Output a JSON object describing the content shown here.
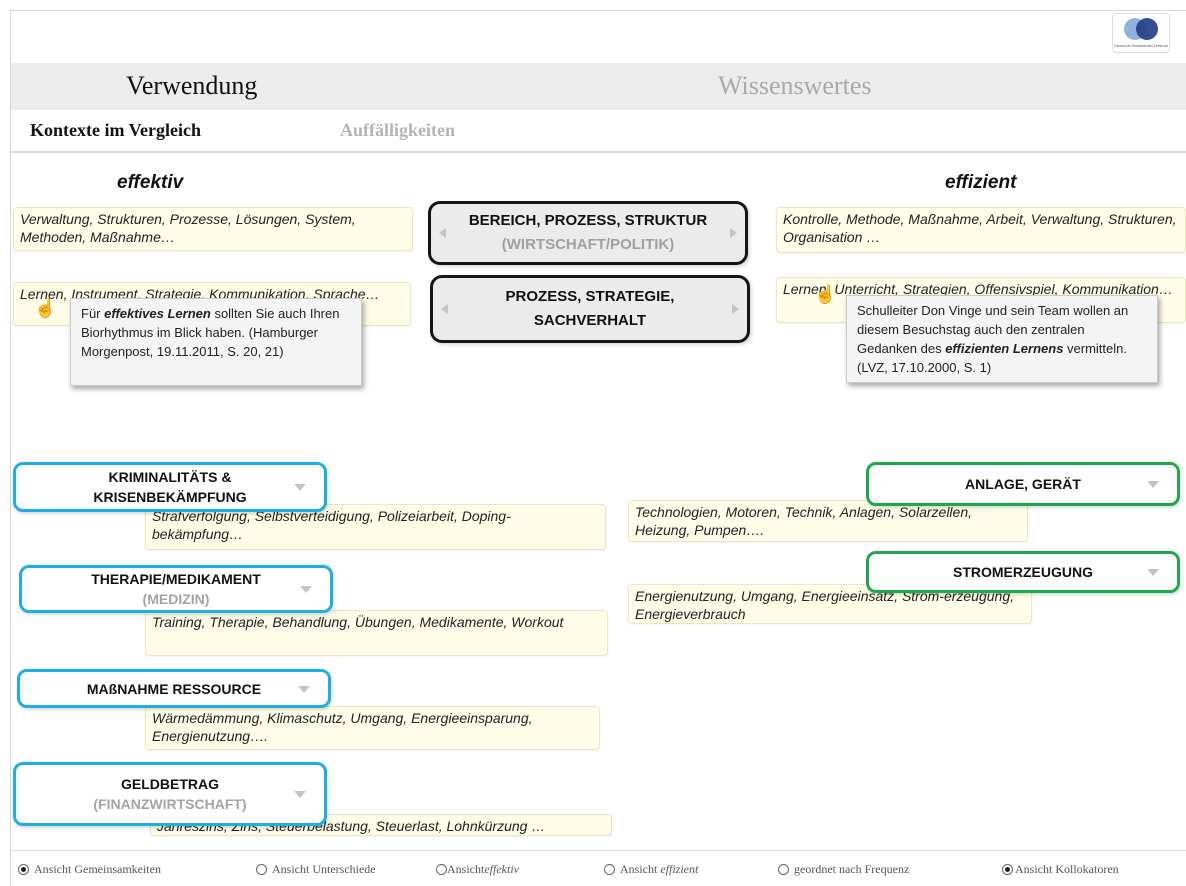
{
  "logo": {
    "icon": "overlapping-circles-logo",
    "text": "Deutsche Wortschatz-Zentrum"
  },
  "tabs": {
    "active": "Verwendung",
    "inactive": "Wissenswertes"
  },
  "subtabs": {
    "active": "Kontexte im Vergleich",
    "inactive": "Auffälligkeiten"
  },
  "columns": {
    "left": "effektiv",
    "right": "effizient"
  },
  "center_boxes": [
    {
      "line1": "BEREICH, PROZESS, STRUKTUR",
      "line2": "(WIRTSCHAFT/POLITIK)"
    },
    {
      "line1": "PROZESS, STRATEGIE,",
      "line2": "SACHVERHALT"
    }
  ],
  "left_notes": [
    "Verwaltung,  Strukturen,  Prozesse, Lösungen, System,  Methoden,  Maßnahme…",
    "Lernen,  Instrument,  Strategie,  Kommunikation, Sprache…"
  ],
  "right_notes": [
    "Kontrolle,  Methode,  Maßnahme,  Arbeit, Verwaltung,  Strukturen,  Organisation  …",
    "Lernen,  Unterricht,  Strategien,  Offensivspiel, Kommunikation…"
  ],
  "tooltips": {
    "left": {
      "pre": "Für ",
      "bold": "effektives Lernen",
      "post": " sollten Sie auch Ihren Biorhythmus im Blick haben. (Hamburger Morgenpost, 19.11.2011, S. 20, 21)"
    },
    "right": {
      "pre": "Schulleiter Don Vinge und sein Team wollen an diesem Besuchstag auch den zentralen Gedanken des ",
      "bold": "effizienten Lernens",
      "post": " vermitteln. (LVZ, 17.10.2000, S. 1)"
    }
  },
  "left_categories": [
    {
      "line1": "KRIMINALITÄTS &",
      "line2": "KRISENBEKÄMPFUNG",
      "note": "Strafverfolgung,  Selbstverteidigung,  Polizeiarbeit,  Doping-bekämpfung…"
    },
    {
      "line1": "THERAPIE/MEDIKAMENT",
      "line2": "(MEDIZIN)",
      "note": "Training,  Therapie,  Behandlung,  Übungen,  Medikamente, Workout"
    },
    {
      "line1": "MAßNAHME  RESSOURCE",
      "line2": "",
      "note": "Wärmedämmung,  Klimaschutz,  Umgang, Energieeinsparung,  Energienutzung…."
    },
    {
      "line1": "GELDBETRAG",
      "line2": "(FINANZWIRTSCHAFT)",
      "note": "Jahreszins, Zins,  Steuerbelastung, Steuerlast,  Lohnkürzung …"
    }
  ],
  "right_categories": [
    {
      "line1": "ANLAGE,  GERÄT",
      "note": "Technologien, Motoren,  Technik,  Anlagen, Solarzellen, Heizung, Pumpen…."
    },
    {
      "line1": "STROMERZEUGUNG",
      "note": "Energienutzung, Umgang, Energieeinsatz, Strom-erzeugung, Energieverbrauch"
    }
  ],
  "bottom_options": [
    {
      "label": "Ansicht Gemeinsamkeiten",
      "selected": true
    },
    {
      "label": "Ansicht Unterschiede",
      "selected": false
    },
    {
      "label_prefix": "Ansicht ",
      "label_italic": "effektiv",
      "selected": false
    },
    {
      "label_prefix": "Ansicht ",
      "label_italic": "effizient",
      "selected": false
    },
    {
      "label": "geordnet nach  Frequenz",
      "selected": false
    },
    {
      "label": "Ansicht Kollokatoren",
      "selected": true
    }
  ]
}
